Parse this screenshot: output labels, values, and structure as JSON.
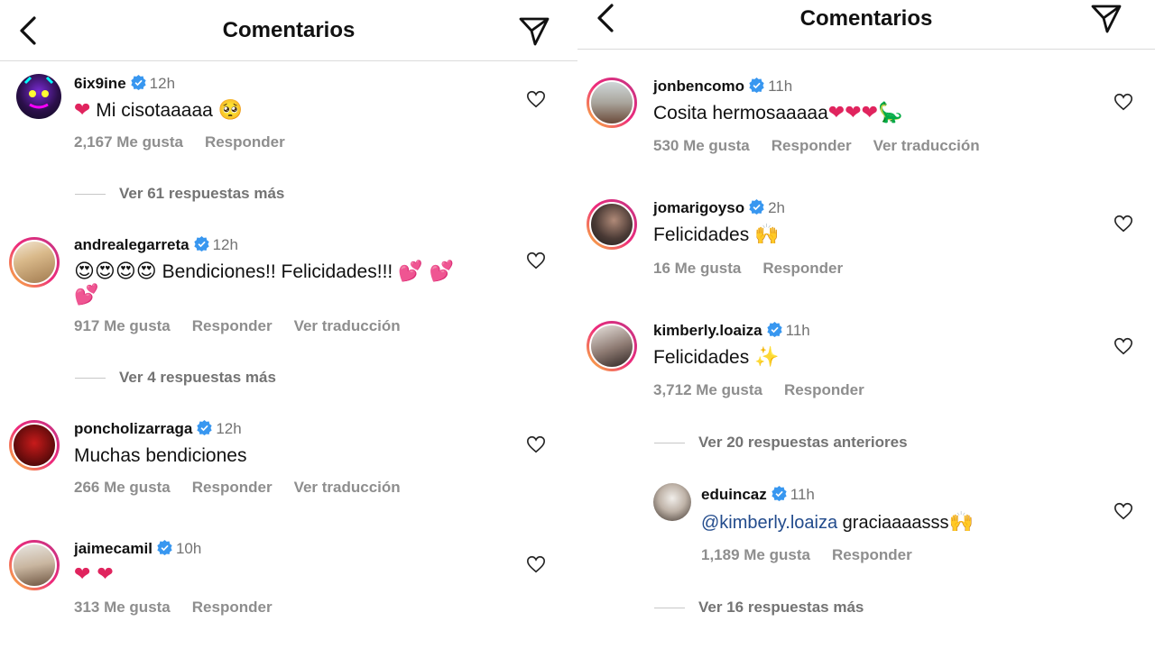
{
  "left": {
    "title": "Comentarios",
    "comments": [
      {
        "username": "6ix9ine",
        "time": "12h",
        "text": "Mi cisotaaaaa",
        "likes": "2,167 Me gusta",
        "reply": "Responder",
        "more_replies": "Ver 61 respuestas más"
      },
      {
        "username": "andrealegarreta",
        "time": "12h",
        "text": "Bendiciones!! Felicidades!!!",
        "likes": "917 Me gusta",
        "reply": "Responder",
        "translate": "Ver traducción",
        "more_replies": "Ver 4 respuestas más"
      },
      {
        "username": "poncholizarraga",
        "time": "12h",
        "text": "Muchas bendiciones",
        "likes": "266 Me gusta",
        "reply": "Responder",
        "translate": "Ver traducción"
      },
      {
        "username": "jaimecamil",
        "time": "10h",
        "likes": "313 Me gusta",
        "reply": "Responder"
      }
    ]
  },
  "right": {
    "title": "Comentarios",
    "comments": [
      {
        "username": "jonbencomo",
        "time": "11h",
        "text": "Cosita hermosaaaaa",
        "likes": "530 Me gusta",
        "reply": "Responder",
        "translate": "Ver traducción"
      },
      {
        "username": "jomarigoyso",
        "time": "2h",
        "text": "Felicidades",
        "likes": "16 Me gusta",
        "reply": "Responder"
      },
      {
        "username": "kimberly.loaiza",
        "time": "11h",
        "text": "Felicidades",
        "likes": "3,712 Me gusta",
        "reply": "Responder",
        "earlier_replies": "Ver 20 respuestas anteriores"
      },
      {
        "username": "eduincaz",
        "time": "11h",
        "mention": "@kimberly.loaiza",
        "text": "graciaaaasss",
        "likes": "1,189 Me gusta",
        "reply": "Responder",
        "more_replies": "Ver 16 respuestas más"
      }
    ]
  },
  "colors": {
    "verified": "#3897f0",
    "muted": "#8e8e8e",
    "mention": "#224b8c",
    "heart": "#e0245e"
  },
  "icons": {
    "back": "chevron-left-icon",
    "send": "paper-plane-icon",
    "like": "heart-outline-icon",
    "verified": "verified-badge-icon"
  }
}
